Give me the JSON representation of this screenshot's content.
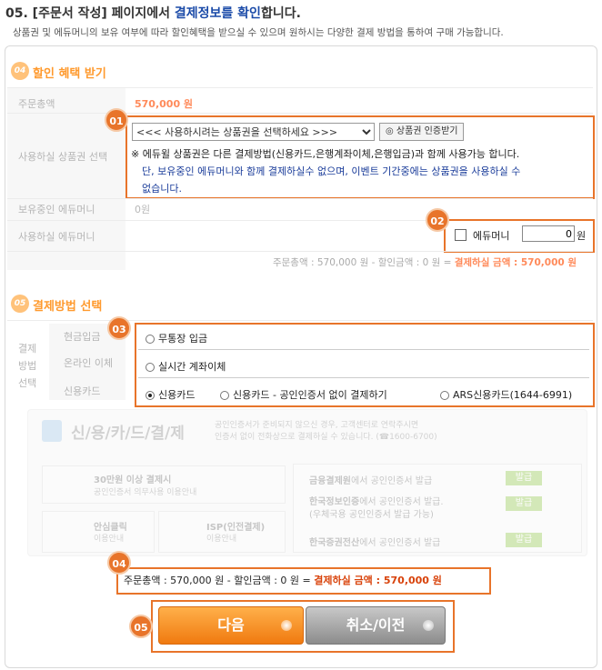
{
  "header": {
    "title_prefix": "05. [주문서 작성] 페이지에서 ",
    "title_highlight": "결제정보를 확인",
    "title_suffix": "합니다.",
    "subtitle": "상품권 및 에듀머니의 보유 여부에 따라 할인혜택을 받으실 수 있으며 원하시는 다양한 결제 방법을 통하여 구매 가능합니다."
  },
  "discount": {
    "section_icon": "04",
    "section_title": "할인 혜택 받기",
    "order_total_label": "주문총액",
    "order_total_value": "570,000 원",
    "coupon_label": "사용하실 상품권 선택",
    "coupon_select": "<<< 사용하시려는 상품권을 선택하세요 >>>",
    "coupon_verify_button": "◎ 상품권 인증받기",
    "notice_line1": "※ 에듀윌 상품권은 다른 결제방법(신용카드,은행계좌이체,은행입금)과 함께 사용가능 합니다.",
    "notice_line2": "단, 보유중인 에듀머니와 함께 결제하실수 없으며, 이벤트 기간중에는 상품권을 사용하실 수",
    "notice_line3": "없습니다.",
    "owned_money_label": "보유중인 에듀머니",
    "owned_money_value": "0원",
    "use_money_label": "사용하실 에듀머니",
    "use_money_checkbox_label": "에듀머니",
    "use_money_input": "0",
    "use_money_unit": "원",
    "summary_prefix": "주문총액 : 570,000 원 - 할인금액 : 0 원 = ",
    "summary_final": "결제하실 금액 : 570,000 원"
  },
  "payment": {
    "section_icon": "05",
    "section_title": "결제방법 선택",
    "side_label": "결제 방법 선택",
    "methods": [
      "현금입금",
      "온라인 이체",
      "신용카드"
    ],
    "option_deposit": "무통장 입금",
    "option_transfer": "실시간 계좌이체",
    "option_card": "신용카드",
    "option_card_no_cert": "신용카드 - 공인인증서 없이 결제하기",
    "option_ars": "ARS신용카드(1644-6991)",
    "card_banner_title": "신/용/카/드/결/제",
    "card_banner_desc1": "공인인증서가 준비되지 않으신 경우, 고객센터로 연락주시면",
    "card_banner_desc2": "인증서 없이 전화상으로 결제하실 수 있습니다. (☎1600-6700)",
    "box1_title": "30만원 이상 결제시",
    "box1_sub": "공인인증서 의무사용 이용안내",
    "box2_title": "안심클릭",
    "box2_sub": "이용안내",
    "box3_title": "ISP(인전결제)",
    "box3_sub": "이용안내",
    "right1_title": "금융결제원",
    "right1_rest": "에서 공인인증서 발급",
    "right2_title": "한국정보인증",
    "right2_rest": "에서 공인인증서 발급.",
    "right2_line2": "(우체국용 공인인증서 발급 가능)",
    "right3_title": "한국증권전산",
    "right3_rest": "에서 공인인증서 발급",
    "issue_button": "발급",
    "summary_prefix": "주문총액 : 570,000 원 - 할인금액 : 0 원 = ",
    "summary_final": "결제하실 금액 : 570,000 원"
  },
  "buttons": {
    "next": "다음",
    "cancel": "취소/이전"
  },
  "badges": [
    "01",
    "02",
    "03",
    "04",
    "05"
  ],
  "colors": {
    "accent": "#e8742a",
    "highlight_blue": "#1a4aa8",
    "amount": "#ff8a5a",
    "final_amount": "#d8420a"
  }
}
